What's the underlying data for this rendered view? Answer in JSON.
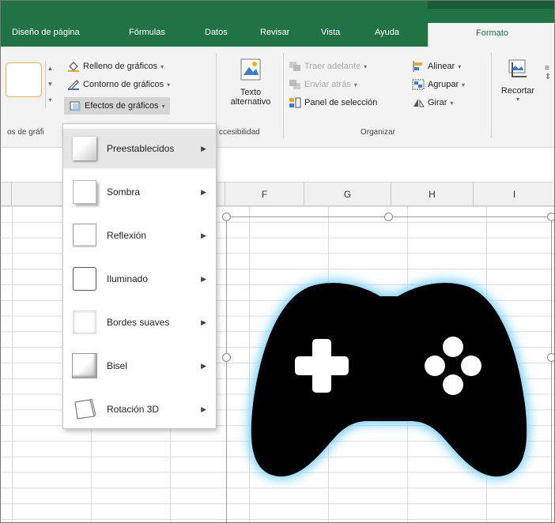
{
  "tabs": [
    {
      "label": "Diseño de página"
    },
    {
      "label": "Fórmulas"
    },
    {
      "label": "Datos"
    },
    {
      "label": "Revisar"
    },
    {
      "label": "Vista"
    },
    {
      "label": "Ayuda"
    },
    {
      "label": "Formato",
      "active": true
    }
  ],
  "ribbon": {
    "relleno": "Relleno de gráficos",
    "contorno": "Contorno de gráficos",
    "efectos": "Efectos de gráficos",
    "texto_alt_1": "Texto",
    "texto_alt_2": "alternativo",
    "traer": "Traer adelante",
    "enviar": "Enviar atrás",
    "panel": "Panel de selección",
    "alinear": "Alinear",
    "agrupar": "Agrupar",
    "girar": "Girar",
    "recortar": "Recortar",
    "group_estilos": "os de gráfi",
    "group_accesibilidad": "ccesibilidad",
    "group_organizar": "Organizar"
  },
  "columns": [
    "F",
    "G",
    "H",
    "I"
  ],
  "menu": {
    "items": [
      {
        "label": "Preestablecidos",
        "underline": "P",
        "style": "preset"
      },
      {
        "label": "Sombra",
        "underline": "S",
        "style": "shadow"
      },
      {
        "label": "Reflexión",
        "underline": "x",
        "style": "reflection"
      },
      {
        "label": "Iluminado",
        "underline": "I",
        "style": "glow"
      },
      {
        "label": "Bordes suaves",
        "underline": "d",
        "style": "soft"
      },
      {
        "label": "Bisel",
        "underline": "B",
        "style": "bevel"
      },
      {
        "label": "Rotación 3D",
        "underline": "R",
        "style": "rotation"
      }
    ]
  },
  "colors": {
    "ribbon_green": "#217346",
    "glow": "#7fd0ff",
    "controller": "#000000"
  },
  "icons": [
    "paint-bucket-icon",
    "pen-icon",
    "effects-icon",
    "alt-text-icon",
    "bring-forward-icon",
    "send-backward-icon",
    "selection-pane-icon",
    "align-icon",
    "group-icon",
    "rotate-icon",
    "crop-icon",
    "gamepad-icon"
  ]
}
